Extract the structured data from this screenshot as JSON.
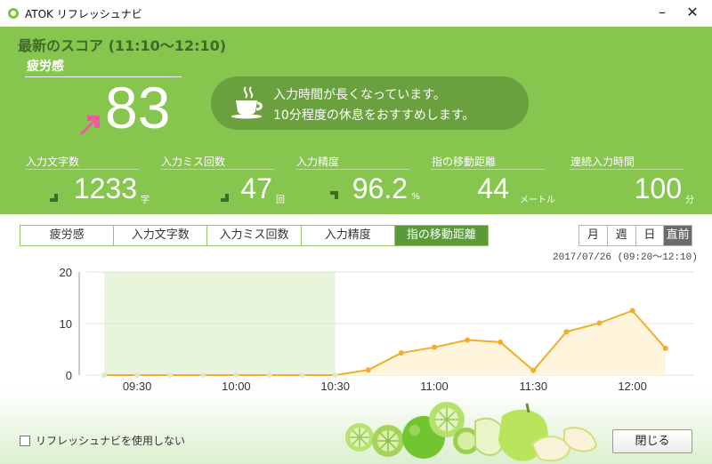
{
  "window": {
    "title": "ATOK リフレッシュナビ",
    "minimize_symbol": "–",
    "close_symbol": "✕"
  },
  "summary": {
    "heading": "最新のスコア (11:10～12:10)",
    "fatigue_label": "疲労感",
    "fatigue_value": "83",
    "fatigue_trend": "up",
    "message_line1": "入力時間が長くなっています。",
    "message_line2": "10分程度の休息をおすすめします。"
  },
  "stats": [
    {
      "label": "入力文字数",
      "value": "1233",
      "unit": "字",
      "trend": "down"
    },
    {
      "label": "入力ミス回数",
      "value": "47",
      "unit": "回",
      "trend": "down"
    },
    {
      "label": "入力精度",
      "value": "96.2",
      "unit": "%",
      "trend": "up"
    },
    {
      "label": "指の移動距離",
      "value": "44",
      "unit": "メートル",
      "trend": ""
    },
    {
      "label": "連続入力時間",
      "value": "100",
      "unit": "分",
      "trend": ""
    }
  ],
  "tabs": [
    "疲労感",
    "入力文字数",
    "入力ミス回数",
    "入力精度",
    "指の移動距離"
  ],
  "active_tab": "指の移動距離",
  "periods": [
    "月",
    "週",
    "日",
    "直前"
  ],
  "active_period": "直前",
  "date_range": "2017/07/26 (09:20～12:10)",
  "chart_data": {
    "type": "area",
    "x": [
      "09:20",
      "09:30",
      "09:40",
      "09:50",
      "10:00",
      "10:10",
      "10:20",
      "10:30",
      "10:40",
      "10:50",
      "11:00",
      "11:10",
      "11:20",
      "11:30",
      "11:40",
      "11:50",
      "12:00",
      "12:10"
    ],
    "y": [
      0,
      0,
      0,
      0,
      0,
      0,
      0,
      0,
      1,
      4.3,
      5.4,
      6.8,
      6.4,
      0.9,
      8.4,
      10.1,
      12.5,
      5.2
    ],
    "x_tick_labels": [
      "09:30",
      "10:00",
      "10:30",
      "11:00",
      "11:30",
      "12:00"
    ],
    "y_tick_labels": [
      "0",
      "10",
      "20"
    ],
    "ylim": [
      0,
      20
    ],
    "highlighted_range": [
      "09:20",
      "10:30"
    ],
    "colors": {
      "line": "#f2ad2a",
      "fill": "#fff5dc",
      "highlight": "#e8f4dc",
      "grid": "#d8e8d0"
    }
  },
  "footer": {
    "checkbox_label": "リフレッシュナビを使用しない",
    "close_button_label": "閉じる"
  },
  "colors": {
    "hero_bg": "#86c64e",
    "hero_dark": "#6aa03d",
    "tab_active": "#5b9a3b",
    "accent_pink": "#ef5b9c"
  }
}
